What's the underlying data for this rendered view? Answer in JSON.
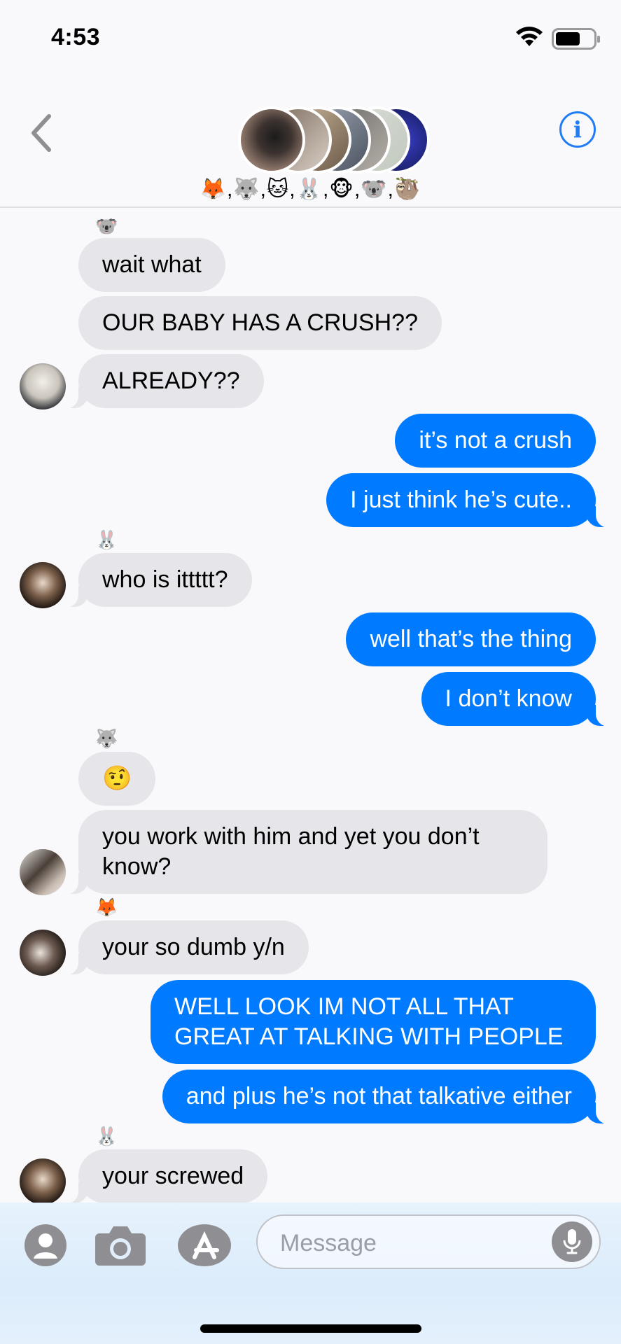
{
  "status_bar": {
    "time": "4:53"
  },
  "header": {
    "group_name": "🦊,🐺,🐱,🐰,🐵,🐨,🦥",
    "info_label": "i"
  },
  "messages": [
    {
      "dir": "in",
      "sender": "🐨",
      "text": "wait what"
    },
    {
      "dir": "in",
      "text": "OUR BABY HAS A CRUSH??"
    },
    {
      "dir": "in",
      "text": "ALREADY??"
    },
    {
      "dir": "out",
      "text": "it’s not a crush"
    },
    {
      "dir": "out",
      "text": "I just think he’s cute.."
    },
    {
      "dir": "in",
      "sender": "🐰",
      "text": "who is ittttt?"
    },
    {
      "dir": "out",
      "text": "well that’s the thing"
    },
    {
      "dir": "out",
      "text": "I don’t know"
    },
    {
      "dir": "in",
      "sender": "🐺",
      "text": "🤨"
    },
    {
      "dir": "in",
      "text": "you work with him and yet you don’t know?"
    },
    {
      "dir": "in",
      "sender": "🦊",
      "text": "your so dumb y/n"
    },
    {
      "dir": "out",
      "text": "WELL LOOK IM NOT ALL THAT GREAT AT TALKING WITH PEOPLE"
    },
    {
      "dir": "out",
      "text": "and plus he’s not that talkative either"
    },
    {
      "dir": "in",
      "sender": "🐰",
      "text": "your screwed"
    }
  ],
  "input": {
    "placeholder": "Message"
  },
  "colors": {
    "accent": "#007aff",
    "incoming_bubble": "#e5e5ea",
    "background": "#f9f9fb"
  }
}
